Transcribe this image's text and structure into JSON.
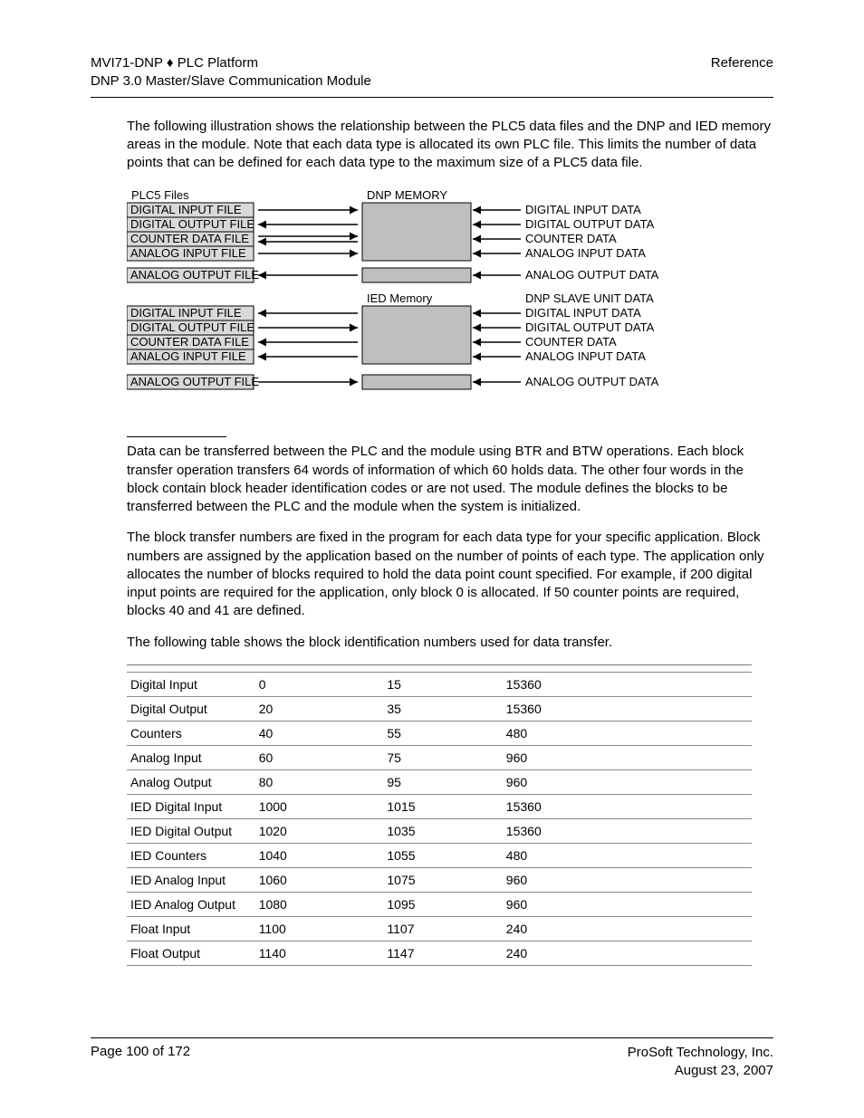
{
  "header": {
    "title_line1_left": "MVI71-DNP",
    "title_sep": "♦",
    "title_line1_right": "PLC Platform",
    "title_line2": "DNP 3.0 Master/Slave Communication Module",
    "section": "Reference"
  },
  "paragraphs": {
    "p1": "The following illustration shows the relationship between the PLC5 data files and the DNP and IED memory areas in the module. Note that each data type is allocated its own PLC file. This limits the number of data points that can be defined for each data type to the maximum size of a PLC5 data file.",
    "p2": "Data can be transferred between the PLC and the module using BTR and BTW operations. Each block transfer operation transfers 64 words of information of which 60 holds data. The other four words in the block contain block header identification codes or are not used. The module defines the blocks to be transferred between the PLC and the module when the system is initialized.",
    "p3": "The block transfer numbers are fixed in the program for each data type for your specific application. Block numbers are assigned by the application based on the number of points of each type. The application only allocates the number of blocks required to hold the data point count specified. For example, if 200 digital input points are required for the application, only block 0 is allocated. If 50 counter points are required, blocks 40 and 41 are defined.",
    "p4": "The following table shows the block identification numbers used for data transfer."
  },
  "diagram": {
    "plc_title": "PLC5 Files",
    "dnp_title": "DNP MEMORY",
    "ied_title": "IED Memory",
    "plc_top": [
      "DIGITAL INPUT FILE",
      "DIGITAL OUTPUT FILE",
      "COUNTER DATA FILE",
      "ANALOG INPUT FILE"
    ],
    "plc_top_extra": "ANALOG OUTPUT FILE",
    "plc_bot": [
      "DIGITAL INPUT FILE",
      "DIGITAL OUTPUT FILE",
      "COUNTER DATA FILE",
      "ANALOG INPUT FILE"
    ],
    "plc_bot_extra": "ANALOG OUTPUT FILE",
    "right_top": [
      "DIGITAL INPUT DATA",
      "DIGITAL OUTPUT DATA",
      "COUNTER DATA",
      "ANALOG INPUT DATA"
    ],
    "right_top_extra": "ANALOG OUTPUT DATA",
    "right_bot_header": "DNP SLAVE UNIT DATA",
    "right_bot": [
      "DIGITAL INPUT DATA",
      "DIGITAL OUTPUT DATA",
      "COUNTER DATA",
      "ANALOG INPUT DATA"
    ],
    "right_bot_extra": "ANALOG OUTPUT DATA"
  },
  "table": {
    "rows": [
      {
        "name": "Digital Input",
        "start": "0",
        "end": "15",
        "max": "15360"
      },
      {
        "name": "Digital Output",
        "start": "20",
        "end": "35",
        "max": "15360"
      },
      {
        "name": "Counters",
        "start": "40",
        "end": "55",
        "max": "480"
      },
      {
        "name": "Analog Input",
        "start": "60",
        "end": "75",
        "max": "960"
      },
      {
        "name": "Analog Output",
        "start": "80",
        "end": "95",
        "max": "960"
      },
      {
        "name": "IED Digital Input",
        "start": "1000",
        "end": "1015",
        "max": "15360"
      },
      {
        "name": "IED Digital Output",
        "start": "1020",
        "end": "1035",
        "max": "15360"
      },
      {
        "name": "IED Counters",
        "start": "1040",
        "end": "1055",
        "max": "480"
      },
      {
        "name": "IED Analog Input",
        "start": "1060",
        "end": "1075",
        "max": "960"
      },
      {
        "name": "IED Analog Output",
        "start": "1080",
        "end": "1095",
        "max": "960"
      },
      {
        "name": "Float Input",
        "start": "1100",
        "end": "1107",
        "max": "240"
      },
      {
        "name": "Float Output",
        "start": "1140",
        "end": "1147",
        "max": "240"
      }
    ]
  },
  "footer": {
    "page": "Page 100 of 172",
    "company": "ProSoft Technology, Inc.",
    "date": "August 23, 2007"
  }
}
